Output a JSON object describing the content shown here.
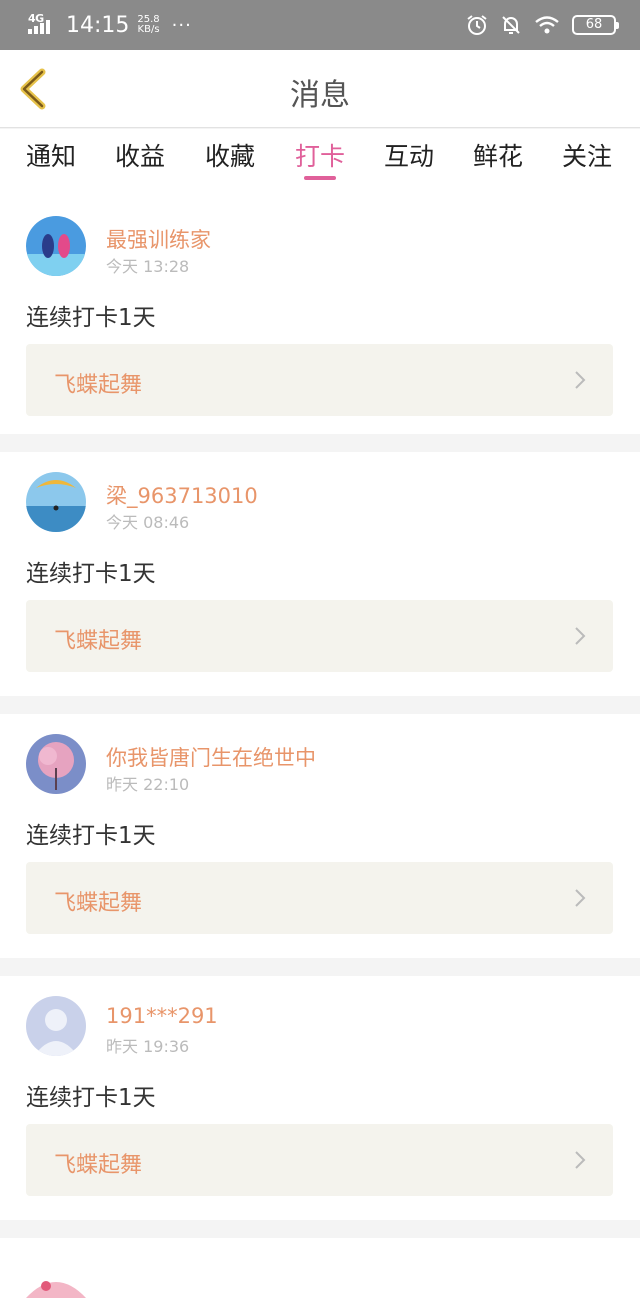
{
  "status_bar": {
    "network": "4G",
    "time": "14:15",
    "speed_value": "25.8",
    "speed_unit": "KB/s",
    "more": "···",
    "battery": "68",
    "icons": [
      "alarm-icon",
      "mute-bell-icon",
      "wifi-icon",
      "battery-icon"
    ]
  },
  "header": {
    "title": "消息",
    "back_icon": "chevron-left-icon"
  },
  "tabs": [
    {
      "label": "通知",
      "active": false
    },
    {
      "label": "收益",
      "active": false
    },
    {
      "label": "收藏",
      "active": false
    },
    {
      "label": "打卡",
      "active": true
    },
    {
      "label": "互动",
      "active": false
    },
    {
      "label": "鲜花",
      "active": false
    },
    {
      "label": "关注",
      "active": false
    }
  ],
  "colors": {
    "accent": "#e0609a",
    "name": "#e8956a",
    "statusbar": "#8a8a8a"
  },
  "items": [
    {
      "name": "最强训练家",
      "time": "今天 13:28",
      "message": "连续打卡1天",
      "link": "飞蝶起舞"
    },
    {
      "name": "梁_963713010",
      "time": "今天 08:46",
      "message": "连续打卡1天",
      "link": "飞蝶起舞"
    },
    {
      "name": "你我皆唐门生在绝世中",
      "time": "昨天 22:10",
      "message": "连续打卡1天",
      "link": "飞蝶起舞"
    },
    {
      "name": "191***291",
      "time": "昨天 19:36",
      "message": "连续打卡1天",
      "link": "飞蝶起舞"
    }
  ]
}
